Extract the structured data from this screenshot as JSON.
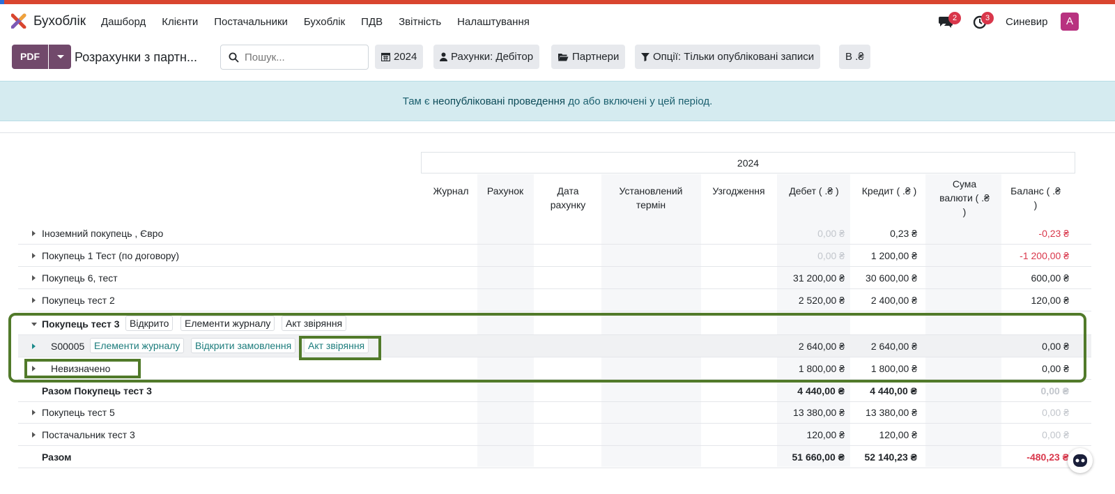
{
  "brand": {
    "name": "Бухоблік",
    "accent": "#71496b"
  },
  "menu": [
    "Дашборд",
    "Клієнти",
    "Постачальники",
    "Бухоблік",
    "ПДВ",
    "Звітність",
    "Налаштування"
  ],
  "nav": {
    "messages_count": "2",
    "activities_count": "3",
    "company": "Синевир",
    "avatar_letter": "A"
  },
  "toolbar": {
    "pdf_label": "PDF",
    "report_title": "Розрахунки з партн...",
    "search_placeholder": "Пошук...",
    "filters": [
      "2024",
      "Рахунки: Дебітор",
      "Партнери",
      "Опції: Тільки опубліковані записи",
      "В .₴"
    ]
  },
  "alert": {
    "prefix": "Там є ",
    "link": "неопубліковані проведення",
    "suffix": " до або включені у цей період."
  },
  "table": {
    "period": "2024",
    "columns": [
      {
        "key": "journal",
        "label": "Журнал"
      },
      {
        "key": "account",
        "label": "Рахунок"
      },
      {
        "key": "invoice_date",
        "label": "Дата рахунку"
      },
      {
        "key": "due_date",
        "label": "Установлений термін"
      },
      {
        "key": "matching",
        "label": "Узгодження"
      },
      {
        "key": "debit",
        "label": "Дебет ( .₴ )"
      },
      {
        "key": "credit",
        "label": "Кредит ( .₴ )"
      },
      {
        "key": "amount_currency",
        "label": "Сума валюти ( .₴ )"
      },
      {
        "key": "balance",
        "label": "Баланс ( .₴ )"
      }
    ],
    "rows": [
      {
        "name": "Іноземний покупець , Євро",
        "debit": "0,00 ₴",
        "credit": "0,23 ₴",
        "balance": "-0,23 ₴"
      },
      {
        "name": "Покупець 1 Тест (по договору)",
        "debit": "0,00 ₴",
        "credit": "1 200,00 ₴",
        "balance": "-1 200,00 ₴"
      },
      {
        "name": "Покупець 6, тест",
        "debit": "31 200,00 ₴",
        "credit": "30 600,00 ₴",
        "balance": "600,00 ₴"
      },
      {
        "name": "Покупець тест 2",
        "debit": "2 520,00 ₴",
        "credit": "2 400,00 ₴",
        "balance": "120,00 ₴"
      },
      {
        "name": "Покупець тест 3",
        "tags": [
          "Відкрито",
          "Елементи журналу",
          "Акт звіряння"
        ]
      },
      {
        "name": "S00005",
        "tags": [
          "Елементи журналу",
          "Відкрити замовлення",
          "Акт звіряння"
        ],
        "debit": "2 640,00 ₴",
        "credit": "2 640,00 ₴",
        "balance": "0,00 ₴"
      },
      {
        "name": "Невизначено",
        "debit": "1 800,00 ₴",
        "credit": "1 800,00 ₴",
        "balance": "0,00 ₴"
      },
      {
        "name": "Разом Покупець тест 3",
        "debit": "4 440,00 ₴",
        "credit": "4 440,00 ₴",
        "balance": "0,00 ₴"
      },
      {
        "name": "Покупець тест 5",
        "debit": "13 380,00 ₴",
        "credit": "13 380,00 ₴",
        "balance": "0,00 ₴"
      },
      {
        "name": "Постачальник тест 3",
        "debit": "120,00 ₴",
        "credit": "120,00 ₴",
        "balance": "0,00 ₴"
      },
      {
        "name": "Разом",
        "debit": "51 660,00 ₴",
        "credit": "52 140,23 ₴",
        "balance": "-480,23 ₴"
      }
    ]
  }
}
